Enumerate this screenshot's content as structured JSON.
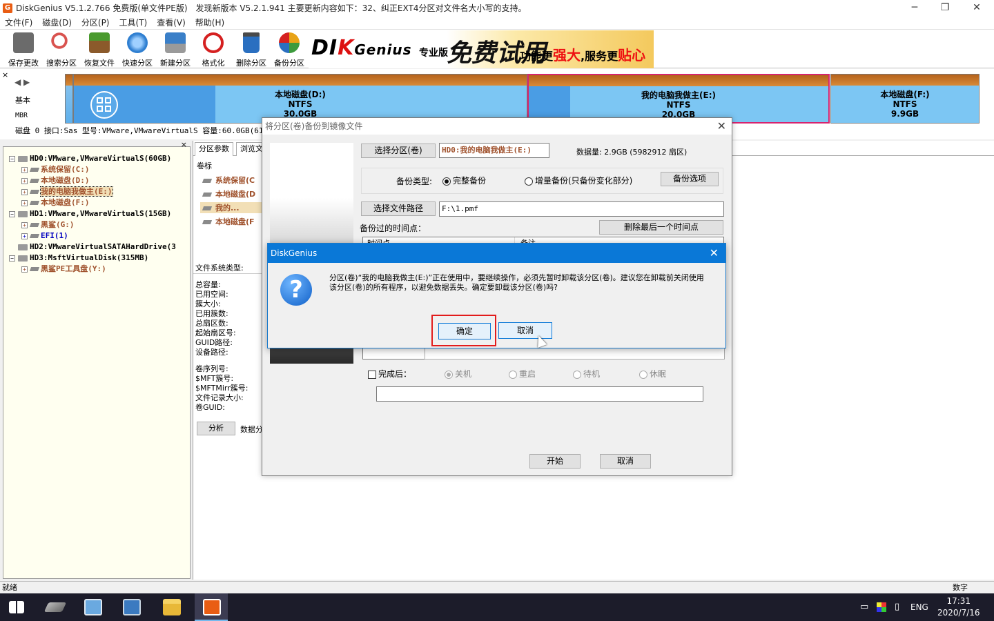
{
  "window": {
    "title": "DiskGenius V5.1.2.766 免费版(单文件PE版)",
    "update_notice": "发现新版本 V5.2.1.941 主要更新内容如下：32、纠正EXT4分区对文件名大小写的支持。",
    "controls": [
      "─",
      "❐",
      "✕"
    ]
  },
  "menu": [
    "文件(F)",
    "磁盘(D)",
    "分区(P)",
    "工具(T)",
    "查看(V)",
    "帮助(H)"
  ],
  "toolbar": [
    {
      "label": "保存更改",
      "icon": "save-icon",
      "color": "#6b6b6b"
    },
    {
      "label": "搜索分区",
      "icon": "search-icon",
      "color": "#d9534f"
    },
    {
      "label": "恢复文件",
      "icon": "recover-icon",
      "color": "#4a9a2e"
    },
    {
      "label": "快速分区",
      "icon": "quick-partition-icon",
      "color": "#2f7fd1"
    },
    {
      "label": "新建分区",
      "icon": "new-partition-icon",
      "color": "#3a7fc8"
    },
    {
      "label": "格式化",
      "icon": "format-icon",
      "color": "#d52020"
    },
    {
      "label": "删除分区",
      "icon": "delete-partition-icon",
      "color": "#2a6fc0"
    },
    {
      "label": "备份分区",
      "icon": "backup-partition-icon",
      "color": "#e8a317"
    }
  ],
  "banner": {
    "brand_left": "DI",
    "brand_k": "K",
    "brand_right": "Genius",
    "edition": "专业版",
    "trial": "免费试用",
    "slogan_a": "功能更",
    "slogan_strong": "强大",
    "slogan_b": ",服务更",
    "slogan_close": "贴心"
  },
  "disk_left": {
    "close": "×",
    "nav": "◀ ▶",
    "basic": "基本",
    "mbr": "MBR"
  },
  "partitions": [
    {
      "name": "本地磁盘(D:)",
      "fs": "NTFS",
      "size": "30.0GB"
    },
    {
      "name": "我的电脑我做主(E:)",
      "fs": "NTFS",
      "size": "20.0GB"
    },
    {
      "name": "本地磁盘(F:)",
      "fs": "NTFS",
      "size": "9.9GB"
    }
  ],
  "disk_info": "磁盘 0 接口:Sas  型号:VMware,VMwareVirtualS  容量:60.0GB(614",
  "tree": {
    "close": "×",
    "rows": [
      {
        "text": "HD0:VMware,VMwareVirtualS(60GB)",
        "kind": "disk"
      },
      {
        "text": "系统保留(C:)",
        "kind": "part"
      },
      {
        "text": "本地磁盘(D:)",
        "kind": "part"
      },
      {
        "text": "我的电脑我做主(E:)",
        "kind": "part-sel"
      },
      {
        "text": "本地磁盘(F:)",
        "kind": "part"
      },
      {
        "text": "HD1:VMware,VMwareVirtualS(15GB)",
        "kind": "disk"
      },
      {
        "text": "黑鲨(G:)",
        "kind": "part"
      },
      {
        "text": "EFI(1)",
        "kind": "part-blue"
      },
      {
        "text": "HD2:VMwareVirtualSATAHardDrive(3",
        "kind": "disk"
      },
      {
        "text": "HD3:MsftVirtualDisk(315MB)",
        "kind": "disk"
      },
      {
        "text": "黑鲨PE工具盘(Y:)",
        "kind": "part"
      }
    ]
  },
  "right": {
    "tabs": [
      "分区参数",
      "浏览文"
    ],
    "volume_label": "卷标",
    "partitions": [
      "系统保留(C",
      "本地磁盘(D",
      "我的...",
      "本地磁盘(F"
    ],
    "fs_type_label": "文件系统类型:",
    "fields": [
      "总容量:",
      "已用空间:",
      "簇大小:",
      "已用簇数:",
      "总扇区数:",
      "起始扇区号:",
      "GUID路径:",
      "设备路径:"
    ],
    "fields2": [
      "卷序列号:",
      "$MFT簇号:",
      "$MFTMirr簇号:",
      "文件记录大小:",
      "卷GUID:"
    ],
    "analyze": "分析",
    "data_dist": "数据分"
  },
  "backup_dialog": {
    "title": "将分区(卷)备份到镜像文件",
    "close": "✕",
    "select_partition": "选择分区(卷)",
    "selected_partition": "HD0:我的电脑我做主(E:)",
    "data_size": "数据量: 2.9GB (5982912 扇区)",
    "backup_type_label": "备份类型:",
    "full_backup": "完整备份",
    "incremental_backup": "增量备份(只备份变化部分)",
    "backup_options": "备份选项",
    "select_path": "选择文件路径",
    "path_value": "F:\\1.pmf",
    "timepoints_label": "备份过的时间点：",
    "delete_last": "删除最后一个时间点",
    "col_time": "时间点",
    "col_note": "备注",
    "after_complete": "完成后：",
    "shutdown": "关机",
    "restart": "重启",
    "standby": "待机",
    "hibernate": "休眠",
    "start": "开始",
    "cancel": "取消"
  },
  "confirm_dialog": {
    "title": "DiskGenius",
    "close": "✕",
    "icon": "?",
    "message": "分区(卷)“我的电脑我做主(E:)”正在使用中，要继续操作，必须先暂时卸载该分区(卷)。建议您在卸载前关闭使用该分区(卷)的所有程序，以避免数据丢失。确定要卸载该分区(卷)吗?",
    "ok": "确定",
    "cancel": "取消"
  },
  "status": {
    "ready": "就绪",
    "num": "数字"
  },
  "taskbar": {
    "items": [
      {
        "icon": "windows-start-icon"
      },
      {
        "icon": "disk-tool-icon"
      },
      {
        "icon": "computer-icon"
      },
      {
        "icon": "network-computer-icon"
      },
      {
        "icon": "folder-icon"
      },
      {
        "icon": "diskgenius-icon"
      }
    ],
    "lang": "ENG",
    "time": "17:31",
    "date": "2020/7/16"
  }
}
